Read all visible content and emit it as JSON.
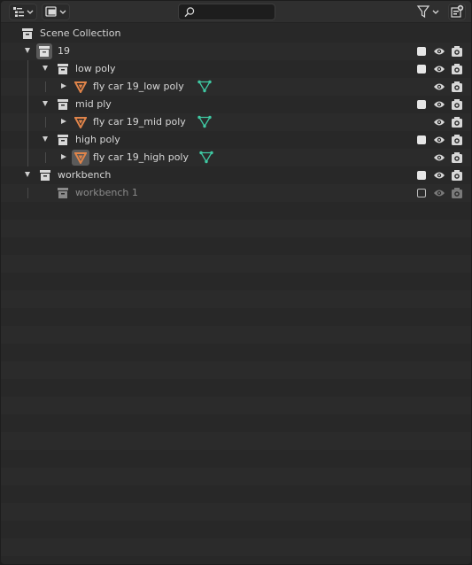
{
  "header": {
    "display_mode_icon": "outliner-view-icon",
    "filter_icon": "funnel-icon",
    "new_collection_icon": "new-collection-icon",
    "search": {
      "value": "",
      "placeholder": ""
    }
  },
  "tree": {
    "scene": {
      "label": "Scene Collection",
      "icon": "scene-collection-icon"
    },
    "rows": [
      {
        "label": "19",
        "type": "collection",
        "excluded_checkbox": true,
        "visible": true,
        "renderable": true
      },
      {
        "label": "low poly",
        "type": "collection",
        "excluded_checkbox": true,
        "visible": true,
        "renderable": true
      },
      {
        "label": "fly car 19_low poly",
        "type": "object",
        "data_icon": "mesh-data-icon",
        "visible": true,
        "renderable": true
      },
      {
        "label": "mid ply",
        "type": "collection",
        "excluded_checkbox": true,
        "visible": true,
        "renderable": true
      },
      {
        "label": "fly car 19_mid poly",
        "type": "object",
        "data_icon": "mesh-data-icon",
        "visible": true,
        "renderable": true
      },
      {
        "label": "high poly",
        "type": "collection",
        "excluded_checkbox": true,
        "visible": true,
        "renderable": true
      },
      {
        "label": "fly car 19_high poly",
        "type": "object",
        "active": true,
        "data_icon": "mesh-data-icon",
        "visible": true,
        "renderable": true
      },
      {
        "label": "workbench",
        "type": "collection",
        "excluded_checkbox": true,
        "visible": true,
        "renderable": true
      },
      {
        "label": "workbench 1",
        "type": "collection",
        "excluded_checkbox": false,
        "visible": true,
        "renderable": true,
        "dimmed": true
      }
    ]
  },
  "colors": {
    "object_orange": "#e0844a",
    "mesh_green": "#3fc9a3",
    "row_alt": "#2b2b2b",
    "background": "#282828"
  }
}
